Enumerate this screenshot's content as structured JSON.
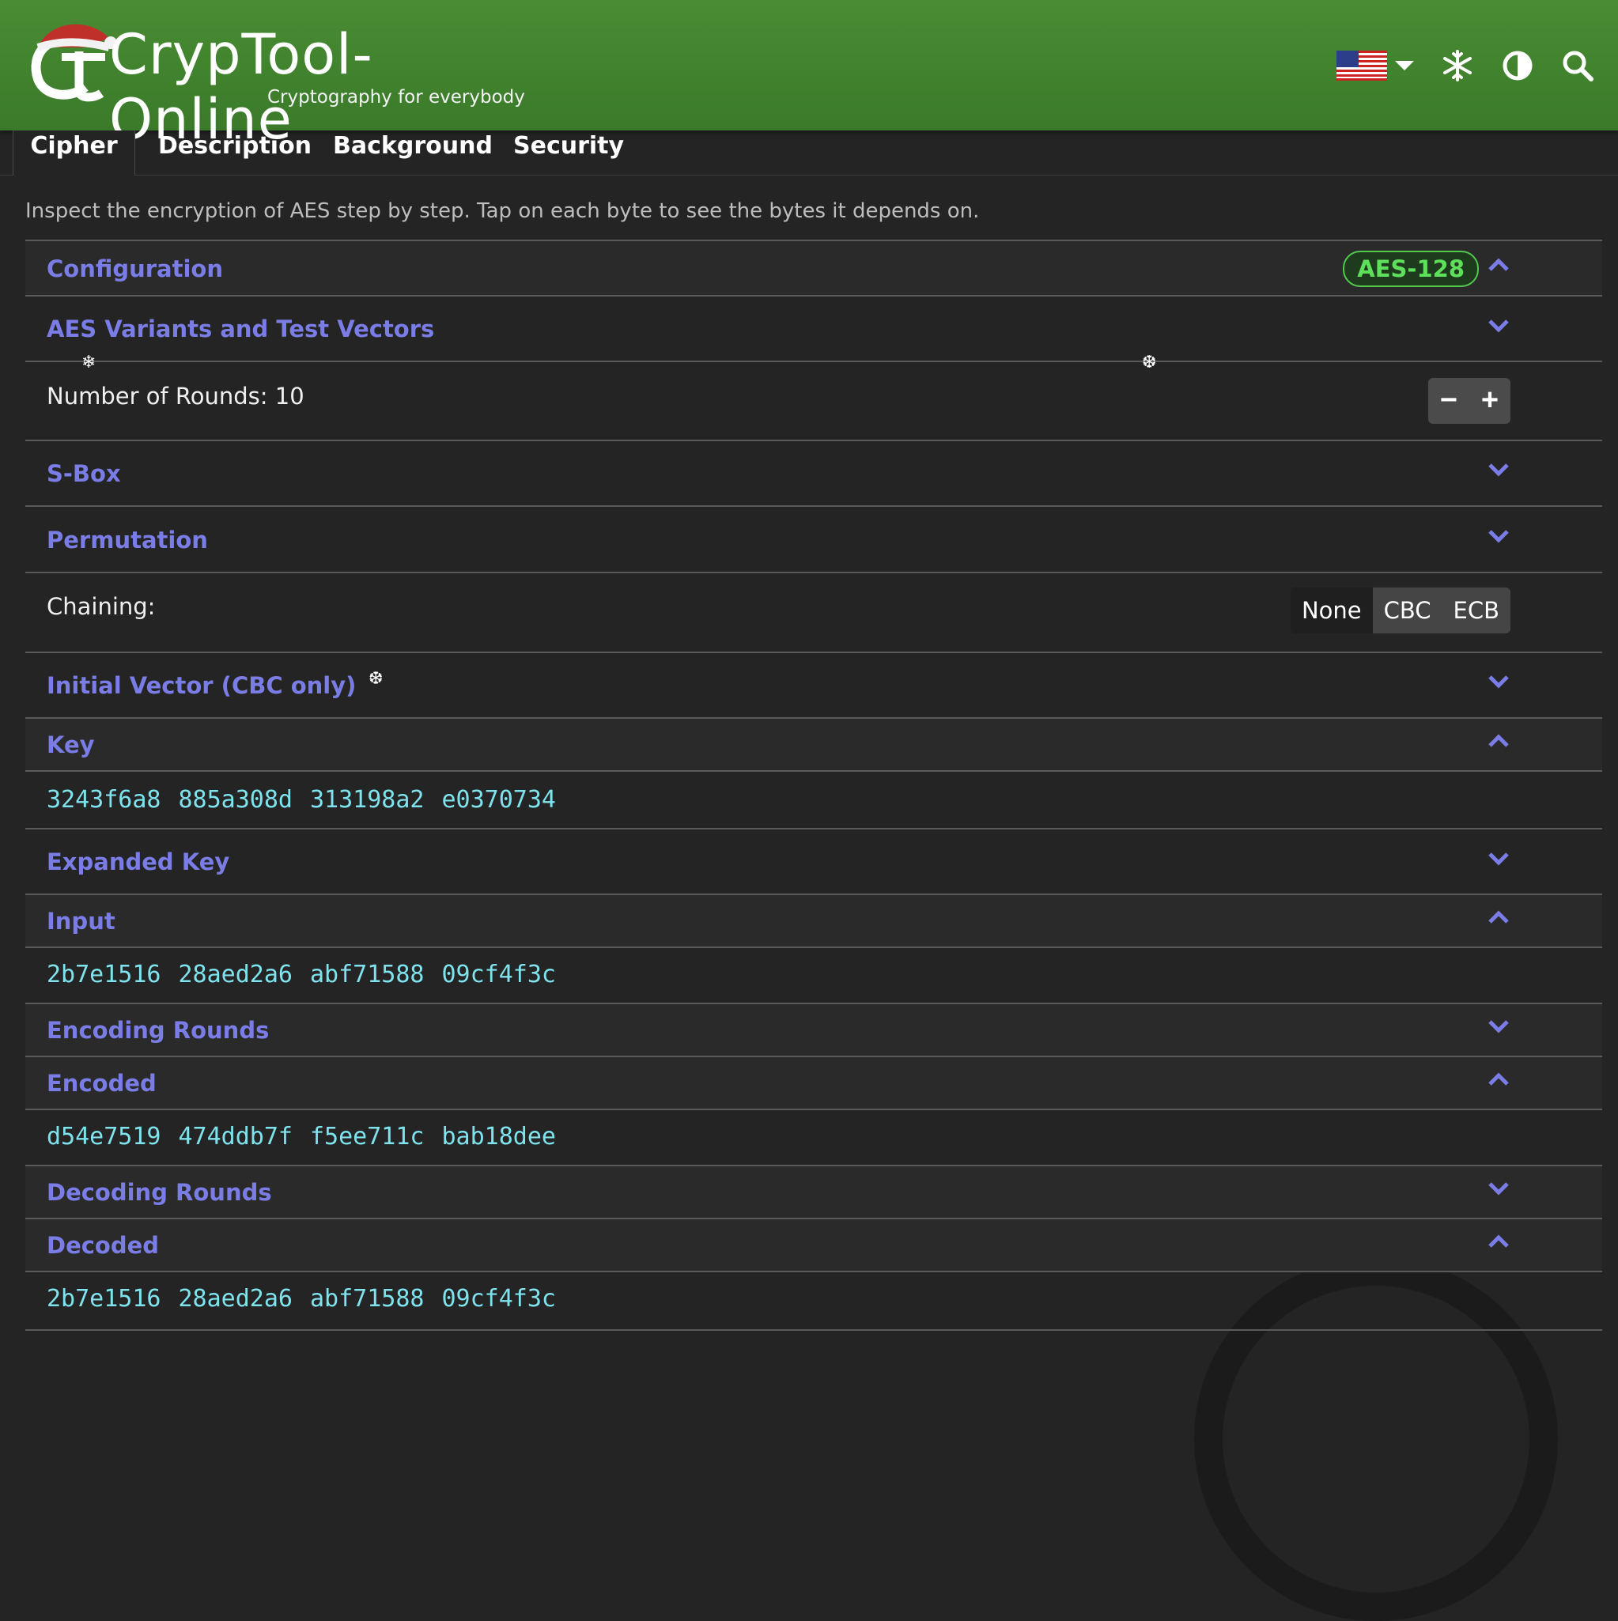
{
  "app": {
    "title": "CrypTool-Online",
    "subtitle": "Cryptography for everybody"
  },
  "header_icons": {
    "language": "us-flag-icon",
    "snow": "snowflake-icon",
    "contrast": "contrast-icon",
    "search": "search-icon"
  },
  "tabs": [
    "Cipher",
    "Description",
    "Background",
    "Security"
  ],
  "intro": "Inspect the encryption of AES step by step. Tap on each byte to see the bytes it depends on.",
  "config": {
    "label": "Configuration",
    "badge": "AES-128"
  },
  "variants_label": "AES Variants and Test Vectors",
  "rounds_label": "Number of Rounds: 10",
  "stepper": {
    "minus": "−",
    "plus": "+"
  },
  "sbox_label": "S-Box",
  "permutation_label": "Permutation",
  "chaining": {
    "label": "Chaining:",
    "options": [
      "None",
      "CBC",
      "ECB"
    ],
    "selected": "CBC"
  },
  "iv_label": "Initial Vector (CBC only)",
  "key": {
    "label": "Key",
    "words": [
      "3243f6a8",
      "885a308d",
      "313198a2",
      "e0370734"
    ]
  },
  "expanded_key_label": "Expanded Key",
  "input": {
    "label": "Input",
    "words": [
      "2b7e1516",
      "28aed2a6",
      "abf71588",
      "09cf4f3c"
    ]
  },
  "encoding_rounds_label": "Encoding Rounds",
  "encoded": {
    "label": "Encoded",
    "words": [
      "d54e7519",
      "474ddb7f",
      "f5ee711c",
      "bab18dee"
    ]
  },
  "decoding_rounds_label": "Decoding Rounds",
  "decoded": {
    "label": "Decoded",
    "words": [
      "2b7e1516",
      "28aed2a6",
      "abf71588",
      "09cf4f3c"
    ]
  },
  "colors": {
    "header_green": "#3f8630",
    "link_purple": "#7a7de6",
    "hex_cyan": "#7fe3ee",
    "badge_green": "#5ee05a"
  }
}
